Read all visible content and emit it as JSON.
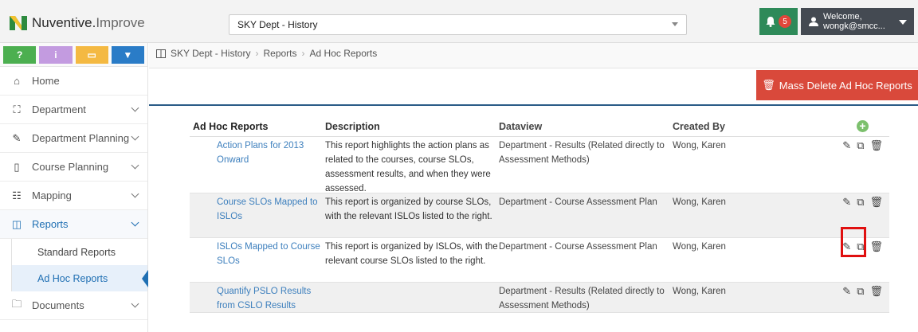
{
  "app": {
    "brand": "Nuventive.",
    "brand_suffix": "Improve",
    "dept_selector": "SKY Dept - History",
    "notifications_count": "5",
    "welcome_line1": "Welcome,",
    "welcome_line2": "wongk@smcc..."
  },
  "toolbar": {
    "help_label": "?",
    "info_label": "i",
    "card_label": "▭",
    "filter_label": "▼"
  },
  "sidebar": {
    "items": [
      {
        "label": "Home"
      },
      {
        "label": "Department"
      },
      {
        "label": "Department Planning"
      },
      {
        "label": "Course Planning"
      },
      {
        "label": "Mapping"
      },
      {
        "label": "Reports"
      },
      {
        "label": "Documents"
      }
    ],
    "subitems": [
      {
        "label": "Standard Reports"
      },
      {
        "label": "Ad Hoc Reports"
      }
    ]
  },
  "breadcrumb": {
    "root": "SKY Dept - History",
    "section": "Reports",
    "page": "Ad Hoc Reports"
  },
  "actions": {
    "mass_delete": "Mass Delete Ad Hoc Reports"
  },
  "table": {
    "headers": [
      "Ad Hoc Reports",
      "Description",
      "Dataview",
      "Created By"
    ],
    "rows": [
      {
        "name": "Action Plans for 2013 Onward",
        "description": "This report highlights the action plans as related to the courses, course SLOs, assessment results, and when they were assessed.",
        "dataview": "Department - Results (Related directly to Assessment Methods)",
        "created_by": "Wong, Karen"
      },
      {
        "name": "Course SLOs Mapped to ISLOs",
        "description": "This report is organized by course SLOs, with the relevant ISLOs listed to the right.",
        "dataview": "Department - Course Assessment Plan",
        "created_by": "Wong, Karen"
      },
      {
        "name": "ISLOs Mapped to Course SLOs",
        "description": "This report is organized by ISLOs, with the relevant course SLOs listed to the right.",
        "dataview": "Department - Course Assessment Plan",
        "created_by": "Wong, Karen"
      },
      {
        "name": "Quantify PSLO Results from CSLO Results",
        "description": "",
        "dataview": "Department - Results (Related directly to Assessment Methods)",
        "created_by": "Wong, Karen"
      }
    ]
  },
  "colors": {
    "accent_blue": "#1f6fb3",
    "danger": "#d9493b",
    "notif_green": "#2e8a59",
    "highlight": "#e01010"
  }
}
